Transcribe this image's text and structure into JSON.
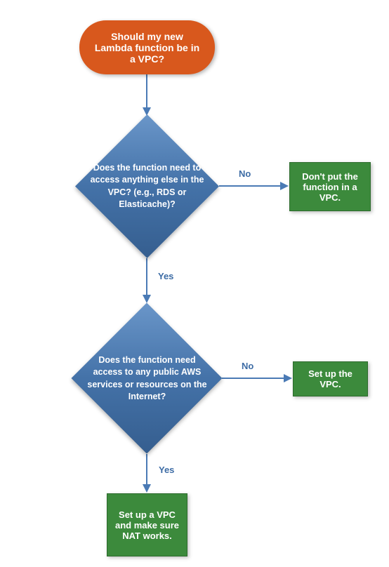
{
  "flowchart": {
    "start": {
      "text": "Should my new Lambda function be in a VPC?"
    },
    "decision1": {
      "text": "Does the function need to access anything else in the VPC? (e.g., RDS or Elasticache)?",
      "yes_label": "Yes",
      "no_label": "No"
    },
    "decision2": {
      "text": "Does the function need access to any public AWS services or resources on the Internet?",
      "yes_label": "Yes",
      "no_label": "No"
    },
    "action1": {
      "text": "Don't put the function in a VPC."
    },
    "action2": {
      "text": "Set up the VPC."
    },
    "action3": {
      "text": "Set up a VPC and make sure NAT works."
    }
  },
  "colors": {
    "start_bg": "#d8581d",
    "decision_bg": "#4a7ab5",
    "action_bg": "#3c8a3c",
    "connector": "#4a7ab5",
    "label": "#3d6ca5"
  }
}
